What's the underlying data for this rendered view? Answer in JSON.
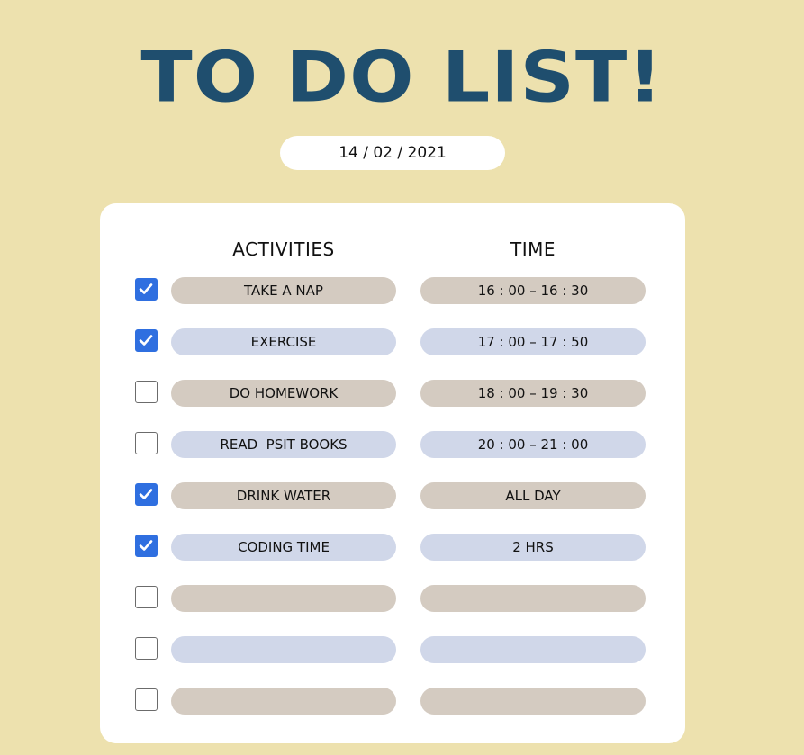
{
  "title": "TO DO LIST!",
  "date": "14 / 02 / 2021",
  "headers": {
    "activities": "ACTIVITIES",
    "time": "TIME"
  },
  "colors": {
    "background": "#ede1ae",
    "title": "#1f4e6e",
    "check": "#2f6fe0",
    "pill_tan": "#d4cbc1",
    "pill_blue": "#d0d7e9"
  },
  "rows": [
    {
      "checked": true,
      "activity": "TAKE A NAP",
      "time": "16 : 00 – 16 : 30"
    },
    {
      "checked": true,
      "activity": "EXERCISE",
      "time": "17 : 00 – 17 : 50"
    },
    {
      "checked": false,
      "activity": "DO HOMEWORK",
      "time": "18 : 00 – 19 : 30"
    },
    {
      "checked": false,
      "activity": "READ  PSIT BOOKS",
      "time": "20 : 00 – 21 : 00"
    },
    {
      "checked": true,
      "activity": "DRINK WATER",
      "time": "ALL DAY"
    },
    {
      "checked": true,
      "activity": "CODING TIME",
      "time": "2 HRS"
    },
    {
      "checked": false,
      "activity": "",
      "time": ""
    },
    {
      "checked": false,
      "activity": "",
      "time": ""
    },
    {
      "checked": false,
      "activity": "",
      "time": ""
    }
  ]
}
